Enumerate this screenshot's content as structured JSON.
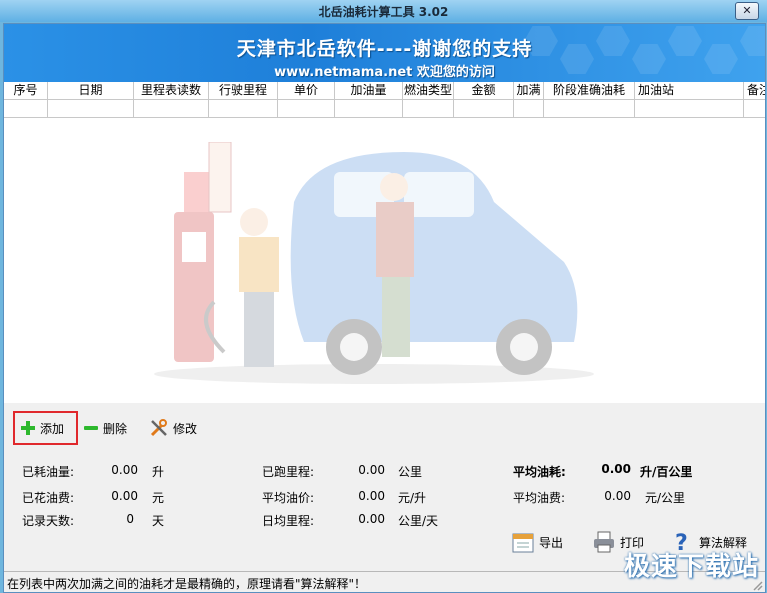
{
  "window": {
    "title": "北岳油耗计算工具 3.02",
    "close_glyph": "✕"
  },
  "banner": {
    "main": "天津市北岳软件----谢谢您的支持",
    "sub": "www.netmama.net 欢迎您的访问"
  },
  "table": {
    "columns": [
      "序号",
      "日期",
      "里程表读数",
      "行驶里程",
      "单价",
      "加油量",
      "燃油类型",
      "金额",
      "加满",
      "阶段准确油耗",
      "加油站",
      "备注"
    ]
  },
  "toolbar": {
    "add": "添加",
    "delete": "删除",
    "edit": "修改"
  },
  "stats": {
    "consumed_fuel": {
      "label": "已耗油量:",
      "value": "0.00",
      "unit": "升"
    },
    "spent_fuel_cost": {
      "label": "已花油费:",
      "value": "0.00",
      "unit": "元"
    },
    "record_days": {
      "label": "记录天数:",
      "value": "0",
      "unit": "天"
    },
    "run_mileage": {
      "label": "已跑里程:",
      "value": "0.00",
      "unit": "公里"
    },
    "avg_price": {
      "label": "平均油价:",
      "value": "0.00",
      "unit": "元/升"
    },
    "daily_mileage": {
      "label": "日均里程:",
      "value": "0.00",
      "unit": "公里/天"
    },
    "avg_consumption": {
      "label": "平均油耗:",
      "value": "0.00",
      "unit": "升/百公里"
    },
    "avg_cost": {
      "label": "平均油费:",
      "value": "0.00",
      "unit": "元/公里"
    }
  },
  "actions": {
    "export": "导出",
    "print": "打印",
    "algorithm": "算法解释"
  },
  "status": {
    "text": "在列表中两次加满之间的油耗才是最精确的，原理请看\"算法解释\"！"
  },
  "watermark": "极速下载站",
  "colors": {
    "banner": "#1e7fd9",
    "highlight": "#e0282c",
    "add_icon": "#2db82d"
  }
}
